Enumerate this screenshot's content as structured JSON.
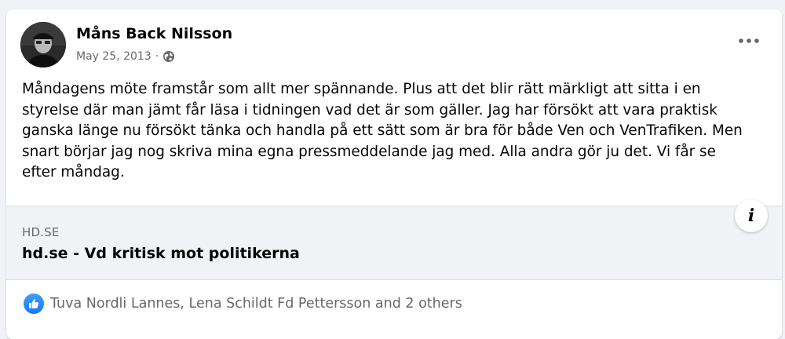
{
  "post": {
    "author": "Måns Back Nilsson",
    "date": "May 25, 2013",
    "separator": "·",
    "privacy_icon": "globe-icon",
    "menu_icon": "more-horizontal-icon",
    "text": "Måndagens möte framstår som allt mer spännande. Plus att det blir rätt märkligt att sitta i en styrelse där man jämt får läsa i tidningen vad det är som gäller. Jag har försökt att vara praktisk ganska länge nu försökt tänka och handla på ett sätt som är bra för både Ven och VenTrafiken. Men snart börjar jag nog skriva mina egna pressmeddelande jag med. Alla andra gör ju det. Vi får se efter måndag."
  },
  "link": {
    "domain": "HD.SE",
    "title": "hd.se - Vd kritisk mot politikerna",
    "info_icon": "info-icon",
    "info_glyph": "i"
  },
  "reactions": {
    "icon": "like-icon",
    "names": "Tuva Nordli Lannes, Lena Schildt Fd Pettersson and 2 others"
  },
  "colors": {
    "page_bg": "#f0f2f5",
    "card_bg": "#ffffff",
    "text_primary": "#050505",
    "text_secondary": "#65676b",
    "like_blue": "#1877f2"
  }
}
